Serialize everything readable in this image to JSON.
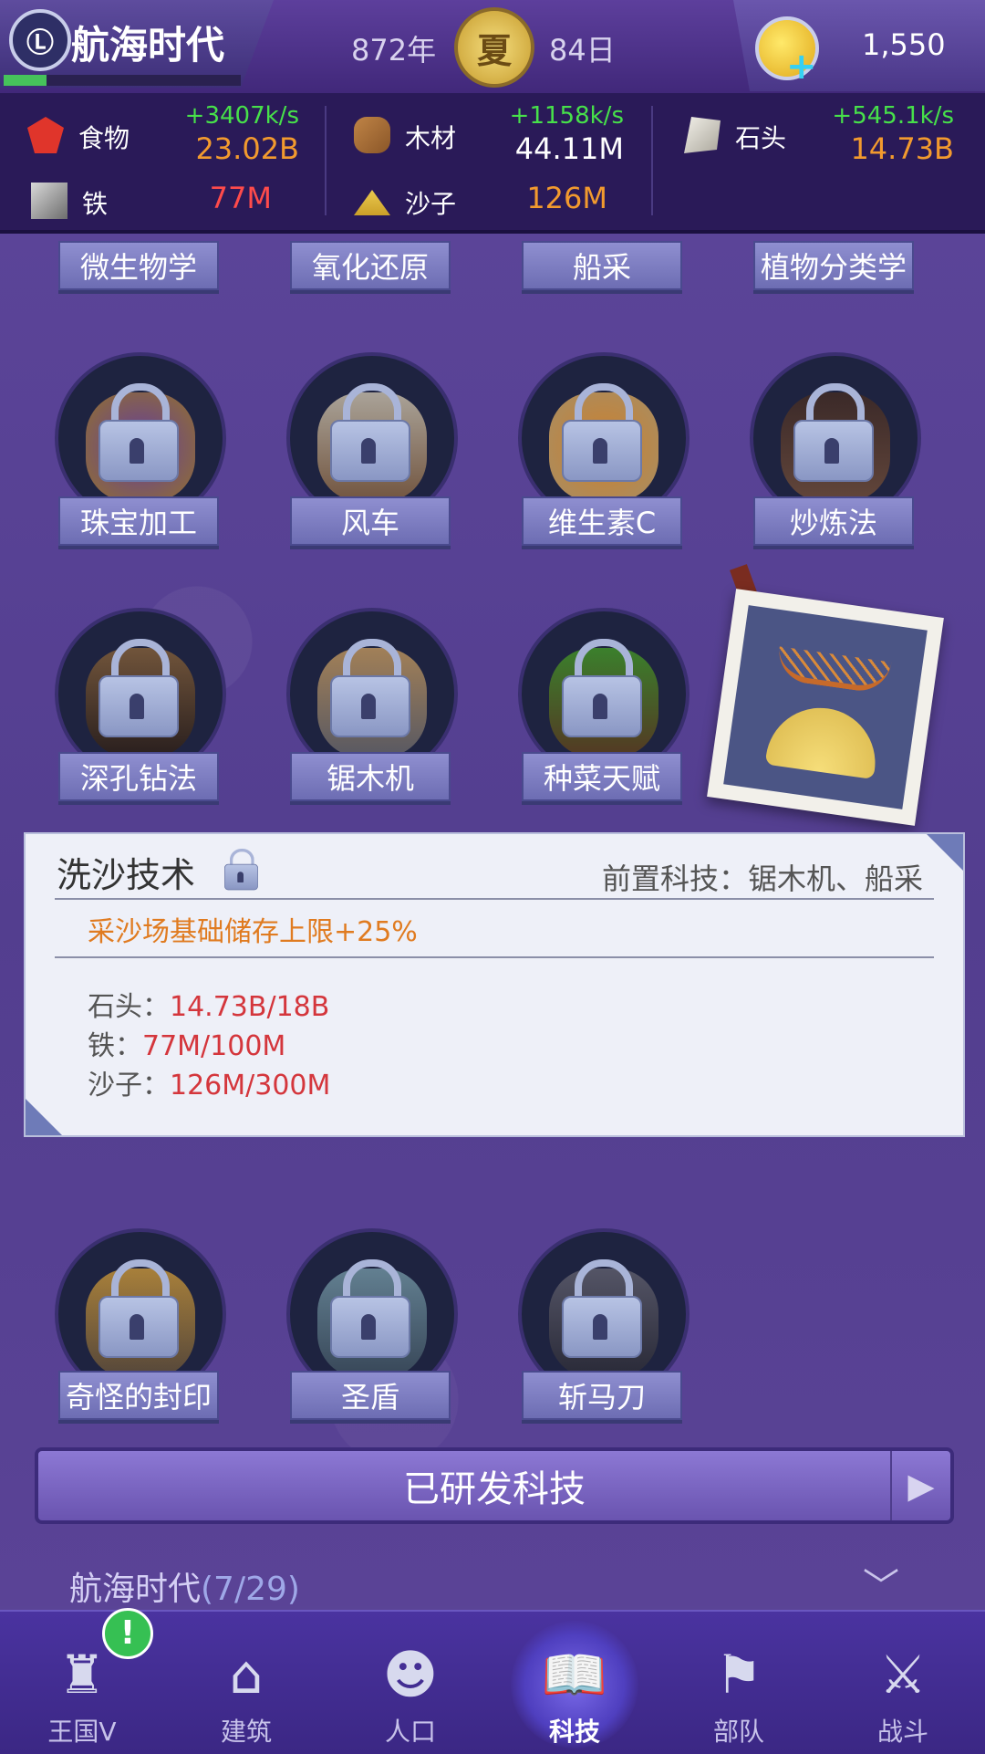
{
  "header": {
    "title": "航海时代",
    "logo": "Ⓛ",
    "progress": 0.18,
    "year": "872年",
    "season": "夏",
    "day": "84日",
    "coins": "1,550"
  },
  "resources": [
    {
      "name": "食物",
      "rate": "+3407k/s",
      "amount": "23.02B",
      "amount_color": "#f29a2e",
      "icon": "apple-icon"
    },
    {
      "name": "木材",
      "rate": "+1158k/s",
      "amount": "44.11M",
      "amount_color": "#ffffff",
      "icon": "wood-icon"
    },
    {
      "name": "石头",
      "rate": "+545.1k/s",
      "amount": "14.73B",
      "amount_color": "#f29a2e",
      "icon": "stone-icon"
    },
    {
      "name": "铁",
      "rate": "",
      "amount": "77M",
      "amount_color": "#ff4b4b",
      "icon": "iron-icon"
    },
    {
      "name": "沙子",
      "rate": "",
      "amount": "126M",
      "amount_color": "#f29a2e",
      "icon": "sand-icon"
    }
  ],
  "top_tags": [
    "微生物学",
    "氧化还原",
    "船采",
    "植物分类学"
  ],
  "row1": [
    "珠宝加工",
    "风车",
    "维生素C",
    "炒炼法"
  ],
  "row2": [
    "深孔钻法",
    "锯木机",
    "种菜天赋"
  ],
  "row3": [
    "奇怪的封印",
    "圣盾",
    "斩马刀"
  ],
  "info": {
    "title": "洗沙技术",
    "prereq": "前置科技：锯木机、船采",
    "effect": "采沙场基础储存上限+25%",
    "requirements": [
      {
        "label": "石头：",
        "value": "14.73B/18B"
      },
      {
        "label": "铁：",
        "value": "77M/100M"
      },
      {
        "label": "沙子：",
        "value": "126M/300M"
      }
    ]
  },
  "researched_button": "已研发科技",
  "era": {
    "name": "航海时代",
    "count": "(7/29)"
  },
  "nav": [
    {
      "label": "王国V",
      "icon": "castle-icon",
      "glyph": "♜"
    },
    {
      "label": "建筑",
      "icon": "house-icon",
      "glyph": "⌂"
    },
    {
      "label": "人口",
      "icon": "person-icon",
      "glyph": "☻"
    },
    {
      "label": "科技",
      "icon": "book-icon",
      "glyph": "📖"
    },
    {
      "label": "部队",
      "icon": "banner-icon",
      "glyph": "⚑"
    },
    {
      "label": "战斗",
      "icon": "swords-icon",
      "glyph": "⚔"
    }
  ],
  "nav_alert": "!"
}
